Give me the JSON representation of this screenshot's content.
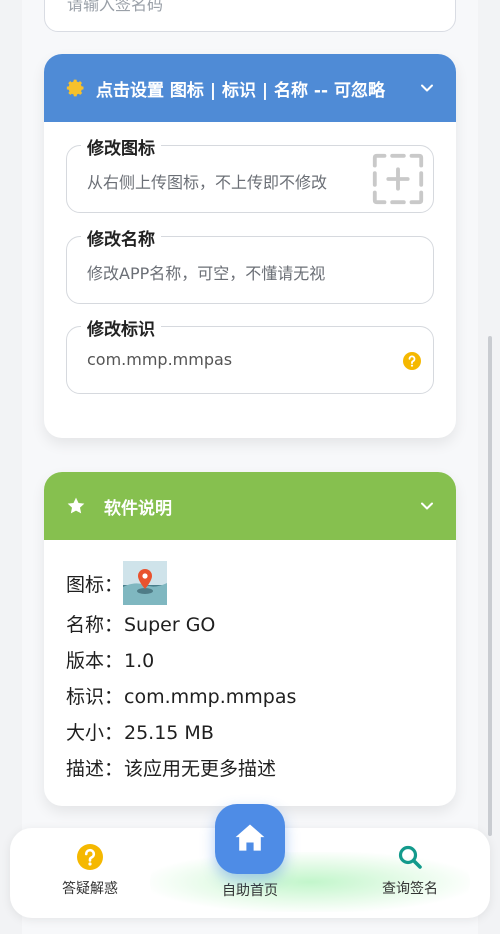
{
  "top_input": {
    "placeholder": "请输入签名码"
  },
  "settings_card": {
    "title": "点击设置 图标 | 标识 | 名称 -- 可忽略",
    "header_color": "#4f8bd6",
    "fields": [
      {
        "label": "修改图标",
        "value": "从右侧上传图标，不上传即不修改"
      },
      {
        "label": "修改名称",
        "value": "修改APP名称，可空，不懂请无视"
      },
      {
        "label": "修改标识",
        "value": "com.mmp.mmpas"
      }
    ]
  },
  "info_card": {
    "title": "软件说明",
    "header_color": "#86c04f",
    "rows": [
      {
        "key": "图标：",
        "value": ""
      },
      {
        "key": "名称：",
        "value": "Super GO"
      },
      {
        "key": "版本：",
        "value": "1.0"
      },
      {
        "key": "标识：",
        "value": "com.mmp.mmpas"
      },
      {
        "key": "大小：",
        "value": "25.15 MB"
      },
      {
        "key": "描述：",
        "value": "该应用无更多描述"
      }
    ]
  },
  "tabbar": {
    "faq": "答疑解惑",
    "home": "自助首页",
    "query": "查询签名",
    "accent": "#4e8ce6"
  }
}
